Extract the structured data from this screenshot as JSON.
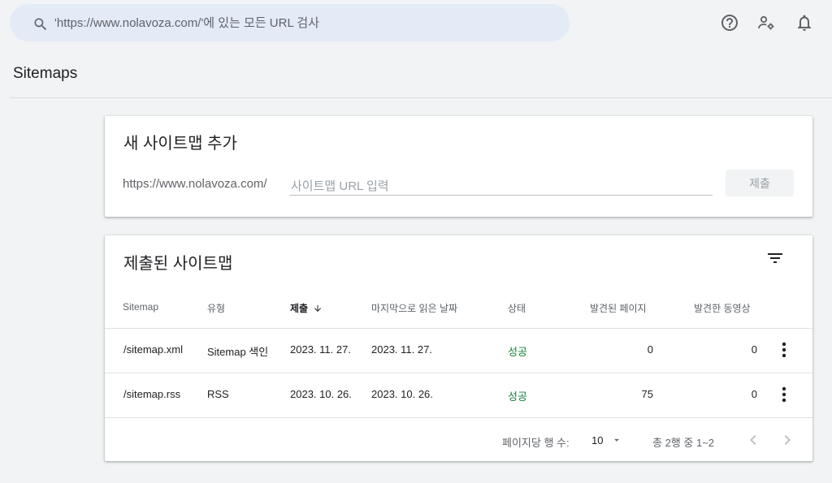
{
  "search": {
    "placeholder": "'https://www.nolavoza.com/'에 있는 모든 URL 검사"
  },
  "header_icons": [
    "help-icon",
    "manage-users-icon",
    "notifications-icon"
  ],
  "page": {
    "title": "Sitemaps"
  },
  "add_sitemap": {
    "title": "새 사이트맵 추가",
    "url_prefix": "https://www.nolavoza.com/",
    "input_placeholder": "사이트맵 URL 입력",
    "submit_label": "제출"
  },
  "submitted": {
    "title": "제출된 사이트맵",
    "columns": [
      "Sitemap",
      "유형",
      "제출",
      "마지막으로 읽은 날짜",
      "상태",
      "발견된 페이지",
      "발견한 동영상"
    ],
    "sort_column": "제출",
    "rows": [
      {
        "sitemap": "/sitemap.xml",
        "type": "Sitemap 색인",
        "submitted": "2023. 11. 27.",
        "last_read": "2023. 11. 27.",
        "status": "성공",
        "pages": "0",
        "videos": "0"
      },
      {
        "sitemap": "/sitemap.rss",
        "type": "RSS",
        "submitted": "2023. 10. 26.",
        "last_read": "2023. 10. 26.",
        "status": "성공",
        "pages": "75",
        "videos": "0"
      }
    ],
    "pagination": {
      "rows_per_page_label": "페이지당 행 수:",
      "rows_per_page_value": "10",
      "range_text": "총 2행 중 1~2"
    }
  },
  "colors": {
    "success": "#188038",
    "search_bg": "#e3ebf7",
    "page_bg": "#f1f3f4"
  }
}
